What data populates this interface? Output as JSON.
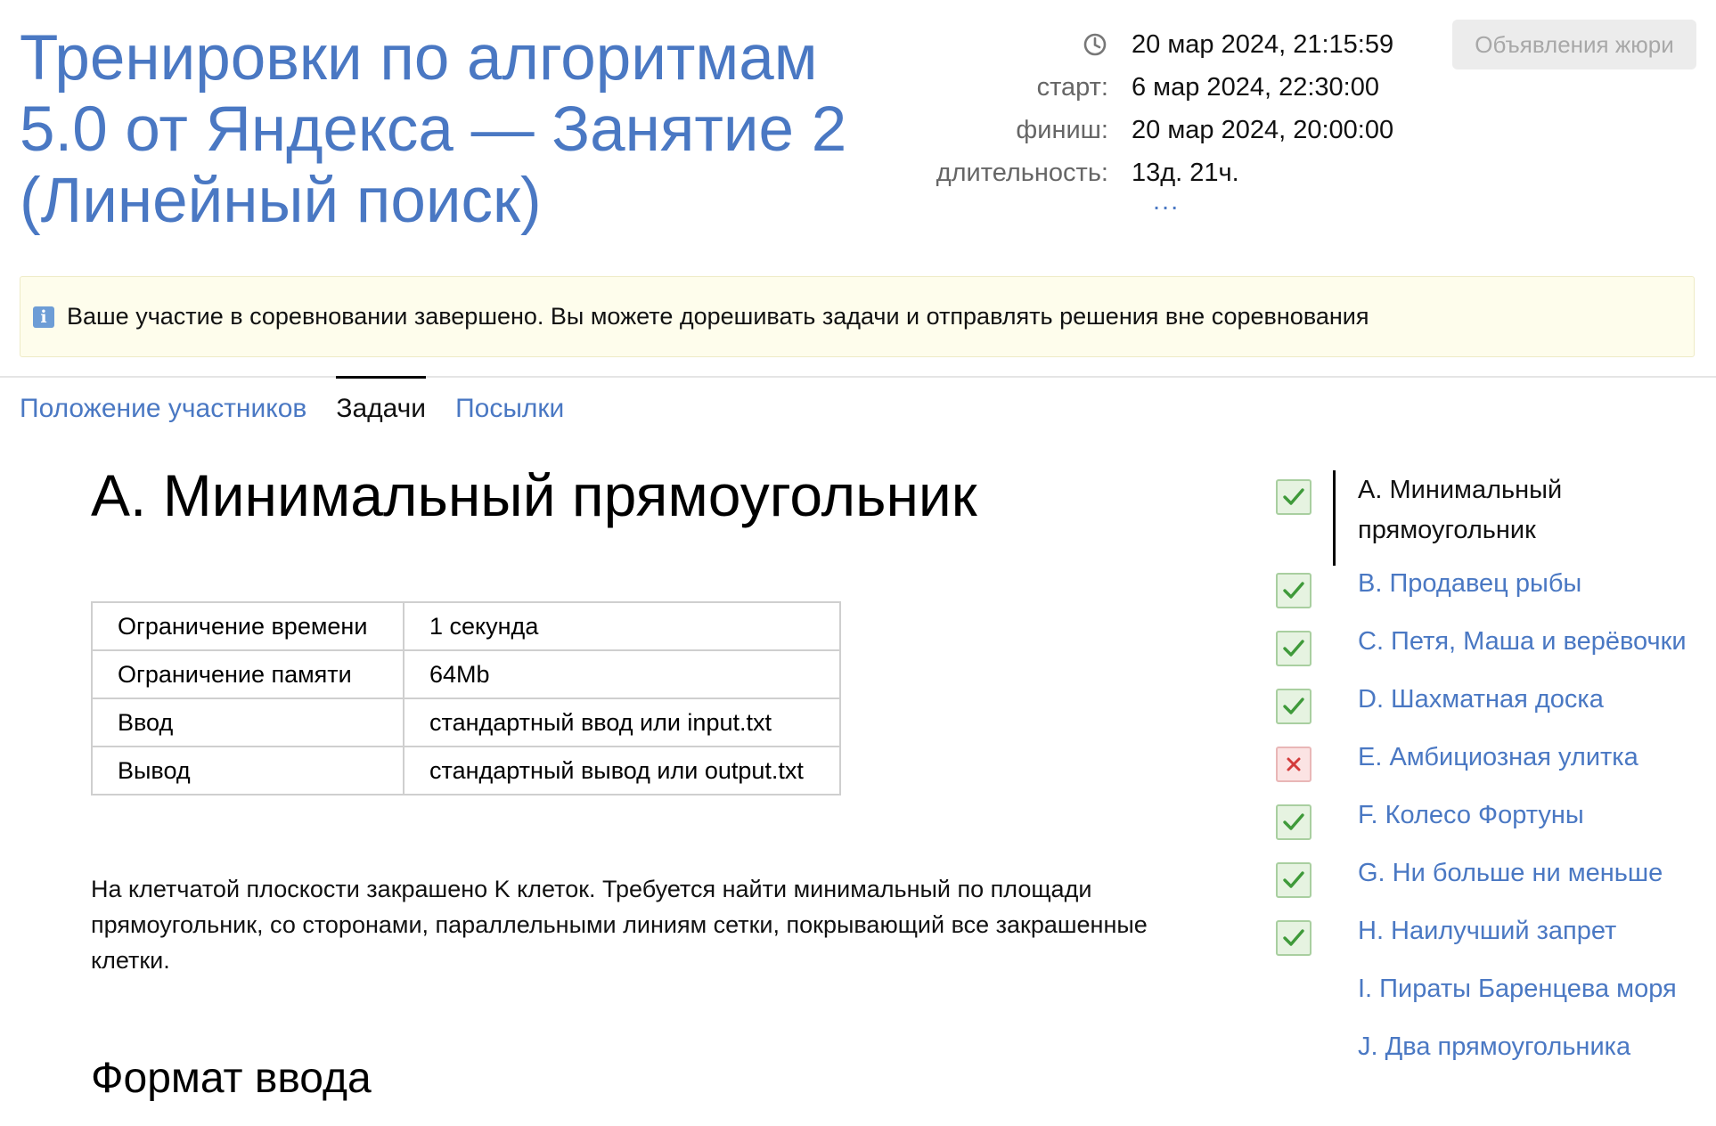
{
  "contest": {
    "title": "Тренировки по алгоритмам 5.0 от Яндекса — Занятие 2 (Линейный поиск)"
  },
  "times": {
    "current": "20 мар 2024, 21:15:59",
    "start_label": "старт:",
    "start": "6 мар 2024, 22:30:00",
    "finish_label": "финиш:",
    "finish": "20 мар 2024, 20:00:00",
    "duration_label": "длительность:",
    "duration": "13д. 21ч.",
    "more": "..."
  },
  "header": {
    "jury_button": "Объявления жюри"
  },
  "notice": {
    "icon": "info-icon",
    "text": "Ваше участие в соревновании завершено. Вы можете дорешивать задачи и отправлять решения вне соревнования"
  },
  "tabs": [
    {
      "label": "Положение участников",
      "active": false
    },
    {
      "label": "Задачи",
      "active": true
    },
    {
      "label": "Посылки",
      "active": false
    }
  ],
  "problem": {
    "title": "A. Минимальный прямоугольник",
    "limits": [
      {
        "key": "Ограничение времени",
        "value": "1 секунда"
      },
      {
        "key": "Ограничение памяти",
        "value": "64Mb"
      },
      {
        "key": "Ввод",
        "value": "стандартный ввод или input.txt"
      },
      {
        "key": "Вывод",
        "value": "стандартный вывод или output.txt"
      }
    ],
    "statement": "На клетчатой плоскости закрашено K клеток. Требуется найти минимальный по площади прямоугольник, со сторонами, параллельными линиям сетки, покрывающий все закрашенные клетки.",
    "input_format_title": "Формат ввода"
  },
  "problem_list": [
    {
      "label": "A. Минимальный прямоугольник",
      "status": "ok",
      "current": true
    },
    {
      "label": "B. Продавец рыбы",
      "status": "ok",
      "current": false
    },
    {
      "label": "C. Петя, Маша и верёвочки",
      "status": "ok",
      "current": false
    },
    {
      "label": "D. Шахматная доска",
      "status": "ok",
      "current": false
    },
    {
      "label": "E. Амбициозная улитка",
      "status": "fail",
      "current": false
    },
    {
      "label": "F. Колесо Фортуны",
      "status": "ok",
      "current": false
    },
    {
      "label": "G. Ни больше ни меньше",
      "status": "ok",
      "current": false
    },
    {
      "label": "H. Наилучший запрет",
      "status": "ok",
      "current": false
    },
    {
      "label": "I. Пираты Баренцева моря",
      "status": "none",
      "current": false
    },
    {
      "label": "J. Два прямоугольника",
      "status": "none",
      "current": false
    }
  ],
  "colors": {
    "link": "#4a78c3",
    "ok_bg": "#e6f3e1",
    "ok_mark": "#3f9a3a",
    "fail_bg": "#fbe3e3",
    "fail_mark": "#d33b3b",
    "notice_bg": "#fefdec"
  }
}
